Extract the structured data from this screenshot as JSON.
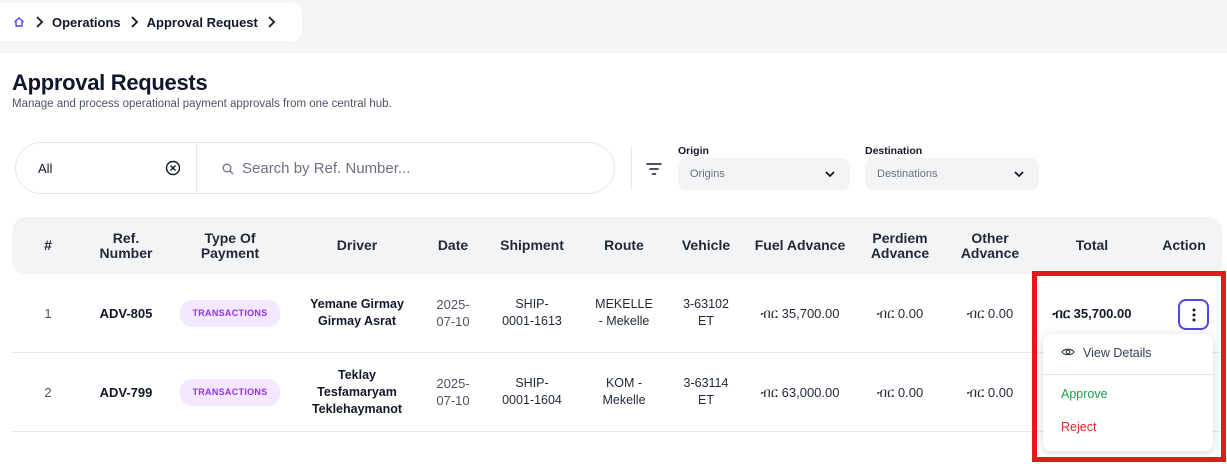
{
  "breadcrumb": {
    "items": [
      "Operations",
      "Approval Request"
    ]
  },
  "header": {
    "title": "Approval Requests",
    "subtitle": "Manage and process operational payment approvals from one central hub."
  },
  "filters": {
    "status_value": "All",
    "search_placeholder": "Search by Ref. Number...",
    "origin_label": "Origin",
    "origin_placeholder": "Origins",
    "destination_label": "Destination",
    "destination_placeholder": "Destinations"
  },
  "table": {
    "columns": {
      "num": "#",
      "ref": "Ref. Number",
      "type": "Type Of Payment",
      "driver": "Driver",
      "date": "Date",
      "shipment": "Shipment",
      "route": "Route",
      "vehicle": "Vehicle",
      "fuel": "Fuel Advance",
      "perdiem": "Perdiem Advance",
      "other": "Other Advance",
      "total": "Total",
      "action": "Action"
    },
    "rows": [
      {
        "num": "1",
        "ref": "ADV-805",
        "type": "TRANSACTIONS",
        "driver": "Yemane Girmay Girmay Asrat",
        "date": "2025-07-10",
        "shipment": "SHIP-0001-1613",
        "route": "MEKELLE - Mekelle",
        "vehicle": "3-63102 ET",
        "fuel": "ብር 35,700.00",
        "perdiem": "ብር 0.00",
        "other": "ብር 0.00",
        "total": "ብር 35,700.00"
      },
      {
        "num": "2",
        "ref": "ADV-799",
        "type": "TRANSACTIONS",
        "driver": "Teklay Tesfamaryam Teklehaymanot",
        "date": "2025-07-10",
        "shipment": "SHIP-0001-1604",
        "route": "KOM - Mekelle",
        "vehicle": "3-63114 ET",
        "fuel": "ብር 63,000.00",
        "perdiem": "ብር 0.00",
        "other": "ብር 0.00",
        "total": ""
      }
    ]
  },
  "action_menu": {
    "view_details": "View Details",
    "approve": "Approve",
    "reject": "Reject"
  },
  "colors": {
    "accent": "#4f46e5",
    "approve": "#16a34a",
    "reject": "#dc2626",
    "badge_text": "#9333ea",
    "highlight": "#e01b1b"
  }
}
